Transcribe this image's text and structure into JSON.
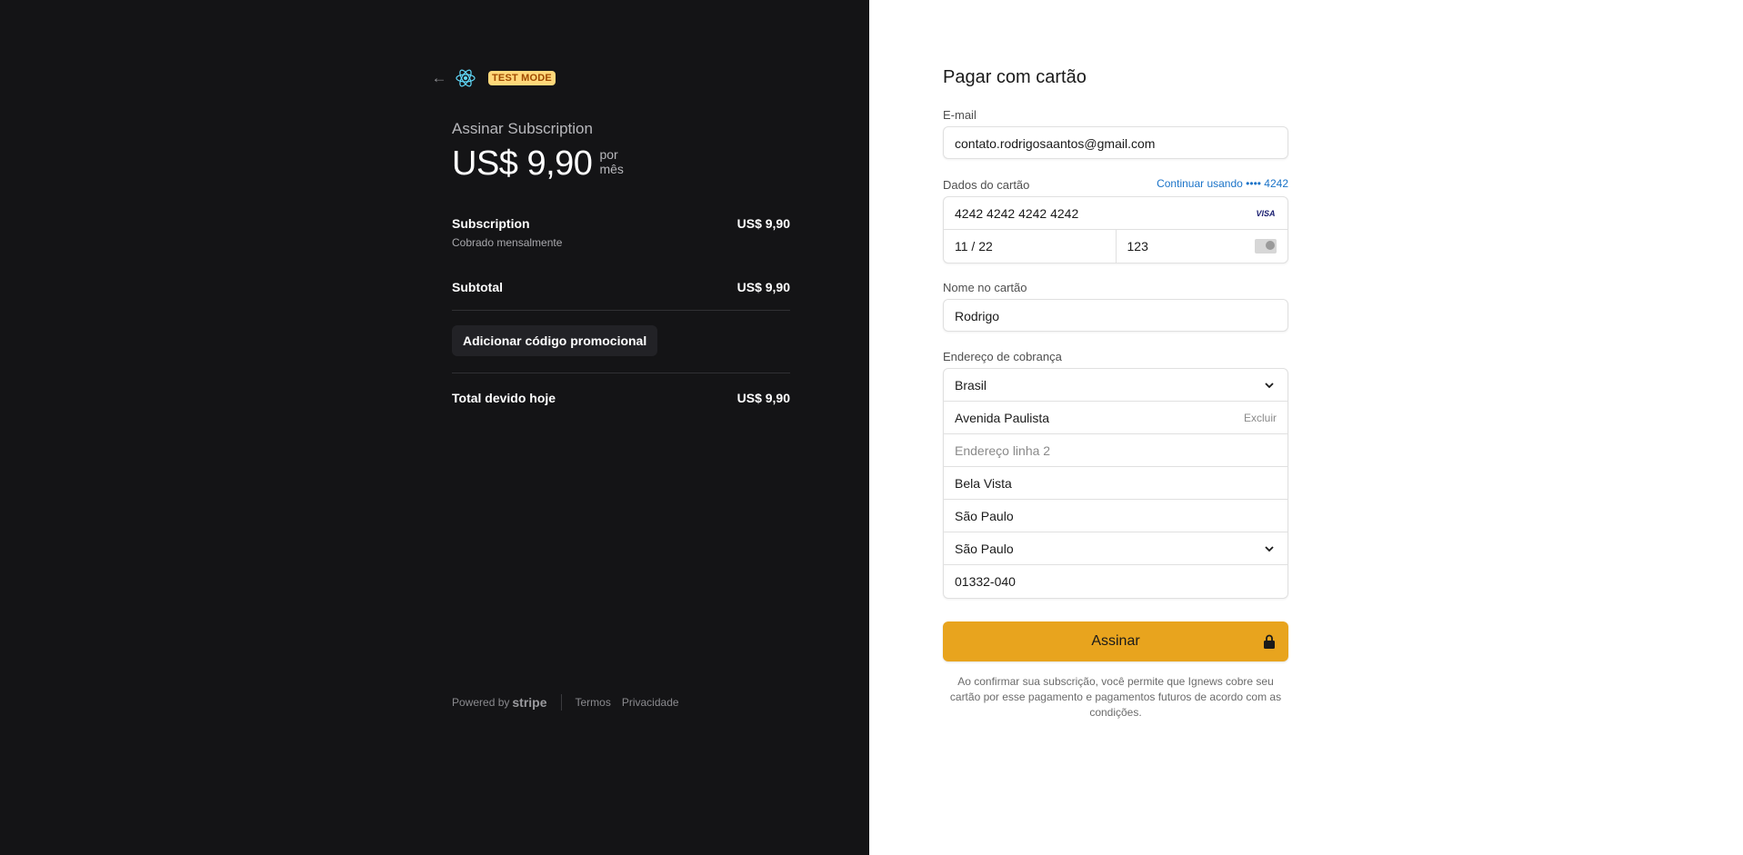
{
  "left": {
    "badge": "TEST MODE",
    "product_title": "Assinar Subscription",
    "price": "US$ 9,90",
    "per_line1": "por",
    "per_line2": "mês",
    "items": [
      {
        "name": "Subscription",
        "amount": "US$ 9,90",
        "sub": "Cobrado mensalmente"
      }
    ],
    "subtotal_label": "Subtotal",
    "subtotal_amount": "US$ 9,90",
    "promo_label": "Adicionar código promocional",
    "total_label": "Total devido hoje",
    "total_amount": "US$ 9,90",
    "footer": {
      "powered_by": "Powered by",
      "stripe": "stripe",
      "terms": "Termos",
      "privacy": "Privacidade"
    }
  },
  "form": {
    "title": "Pagar com cartão",
    "email_label": "E-mail",
    "email_value": "contato.rodrigosaantos@gmail.com",
    "card_label": "Dados do cartão",
    "continue_link": "Continuar usando •••• 4242",
    "card_number": "4242 4242 4242 4242",
    "card_brand": "VISA",
    "expiry": "11 / 22",
    "cvc": "123",
    "name_label": "Nome no cartão",
    "name_value": "Rodrigo",
    "address_label": "Endereço de cobrança",
    "country": "Brasil",
    "address1": "Avenida Paulista",
    "delete_label": "Excluir",
    "address2_placeholder": "Endereço linha 2",
    "neighborhood": "Bela Vista",
    "city": "São Paulo",
    "state": "São Paulo",
    "zip": "01332-040",
    "submit_label": "Assinar",
    "disclaimer": "Ao confirmar sua subscrição, você permite que Ignews cobre seu cartão por esse pagamento e pagamentos futuros de acordo com as condições."
  },
  "colors": {
    "left_bg": "#141416",
    "accent_button": "#e8a41e",
    "link": "#1a73c8",
    "badge_bg": "#ffd87a"
  }
}
